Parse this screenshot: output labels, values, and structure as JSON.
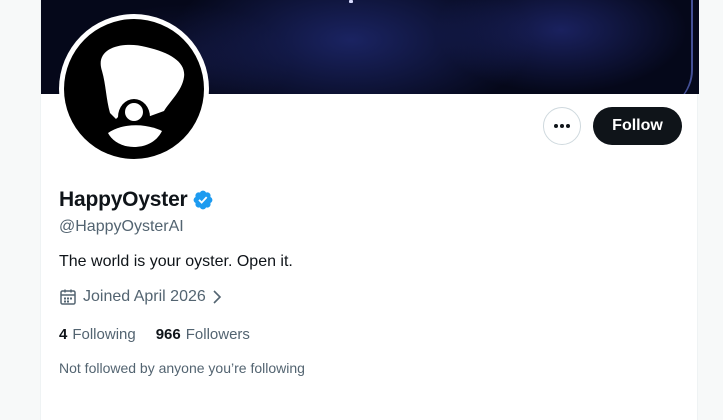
{
  "profile": {
    "display_name": "HappyOyster",
    "handle": "@HappyOysterAI",
    "bio": "The world is your oyster. Open it.",
    "joined": "Joined April 2026",
    "verified": true
  },
  "actions": {
    "more_icon": "more-horizontal-icon",
    "follow_label": "Follow"
  },
  "stats": {
    "following_count": "4",
    "following_label": "Following",
    "followers_count": "966",
    "followers_label": "Followers"
  },
  "mutual_text": "Not followed by anyone you’re following",
  "colors": {
    "text_primary": "#0f1419",
    "text_secondary": "#536471",
    "verified_blue": "#1d9bf0",
    "follow_button_bg": "#0f1419"
  }
}
